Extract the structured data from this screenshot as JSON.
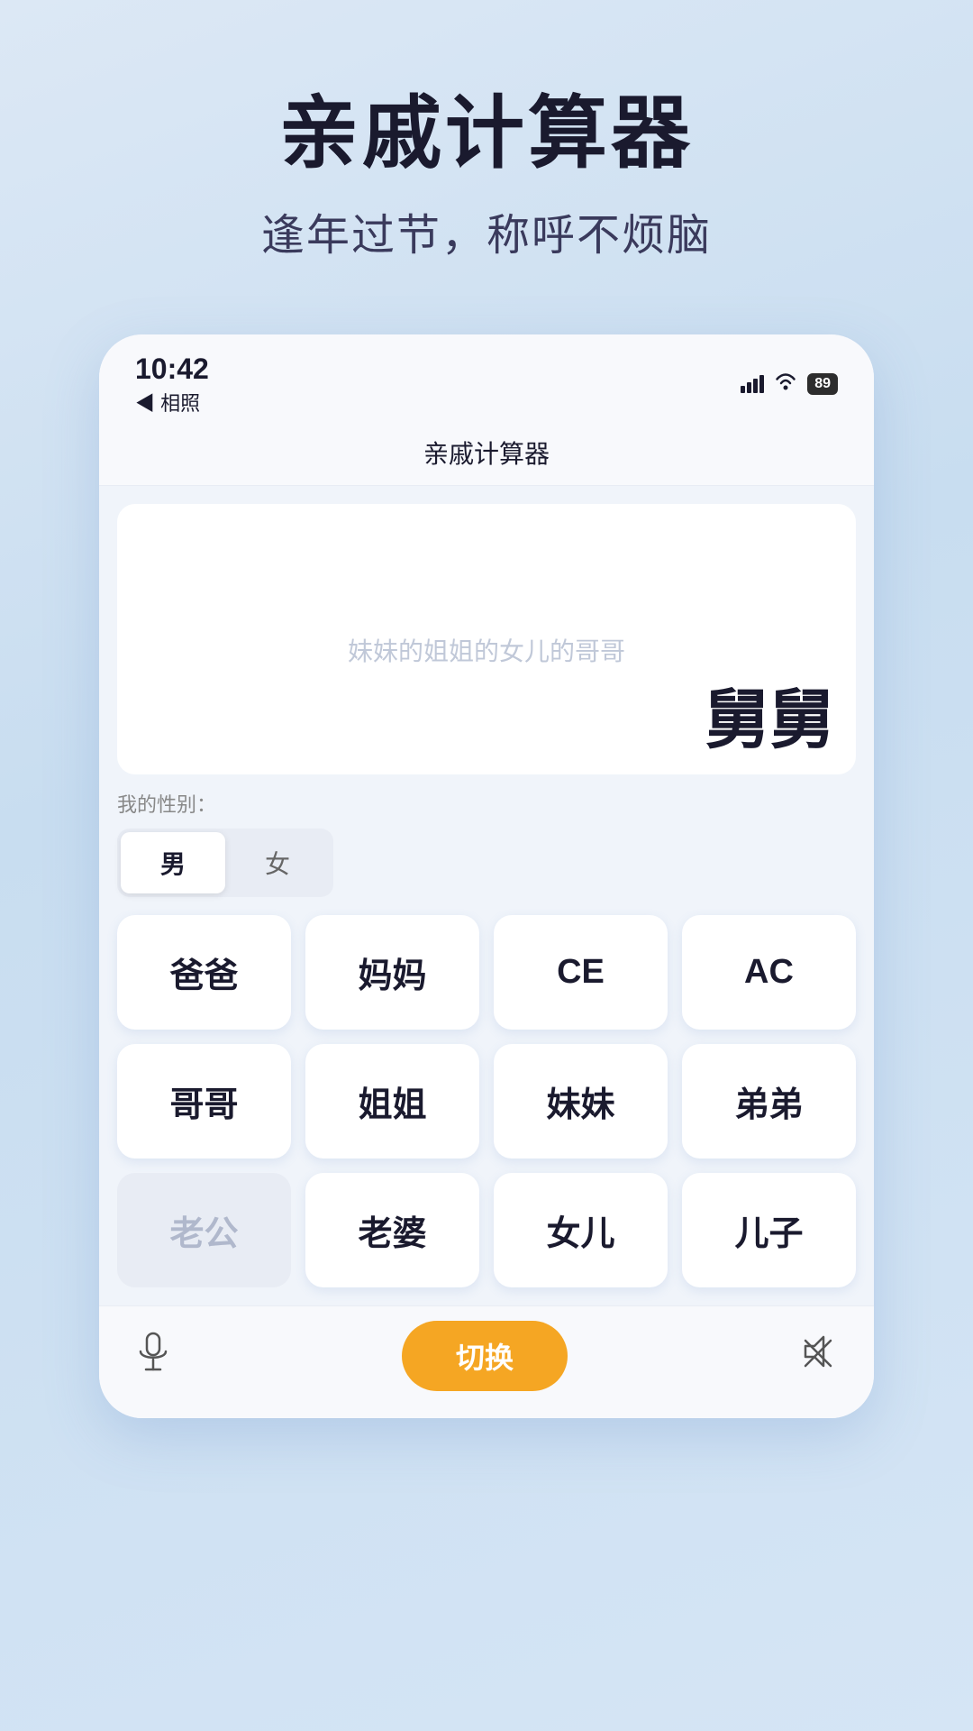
{
  "header": {
    "main_title": "亲戚计算器",
    "sub_title": "逢年过节，称呼不烦脑"
  },
  "status_bar": {
    "time": "10:42",
    "back_label": "◀ 相照",
    "battery": "89"
  },
  "nav": {
    "title": "亲戚计算器"
  },
  "display": {
    "placeholder": "妹妹的姐姐的女儿的哥哥",
    "result": "舅舅"
  },
  "gender": {
    "label": "我的性别：",
    "male": "男",
    "female": "女",
    "active": "male"
  },
  "keypad": {
    "row1": [
      {
        "label": "爸爸",
        "id": "baba",
        "disabled": false
      },
      {
        "label": "妈妈",
        "id": "mama",
        "disabled": false
      },
      {
        "label": "CE",
        "id": "ce",
        "disabled": false
      },
      {
        "label": "AC",
        "id": "ac",
        "disabled": false
      }
    ],
    "row2": [
      {
        "label": "哥哥",
        "id": "gege",
        "disabled": false
      },
      {
        "label": "姐姐",
        "id": "jiejie",
        "disabled": false
      },
      {
        "label": "妹妹",
        "id": "meimei",
        "disabled": false
      },
      {
        "label": "弟弟",
        "id": "didi",
        "disabled": false
      }
    ],
    "row3": [
      {
        "label": "老公",
        "id": "laogong",
        "disabled": true
      },
      {
        "label": "老婆",
        "id": "laopo",
        "disabled": false
      },
      {
        "label": "女儿",
        "id": "nver",
        "disabled": false
      },
      {
        "label": "儿子",
        "id": "erzi",
        "disabled": false
      }
    ]
  },
  "bottom": {
    "switch_label": "切换"
  },
  "colors": {
    "accent": "#f5a623",
    "bg_start": "#dce8f5",
    "bg_end": "#c8ddf0"
  }
}
